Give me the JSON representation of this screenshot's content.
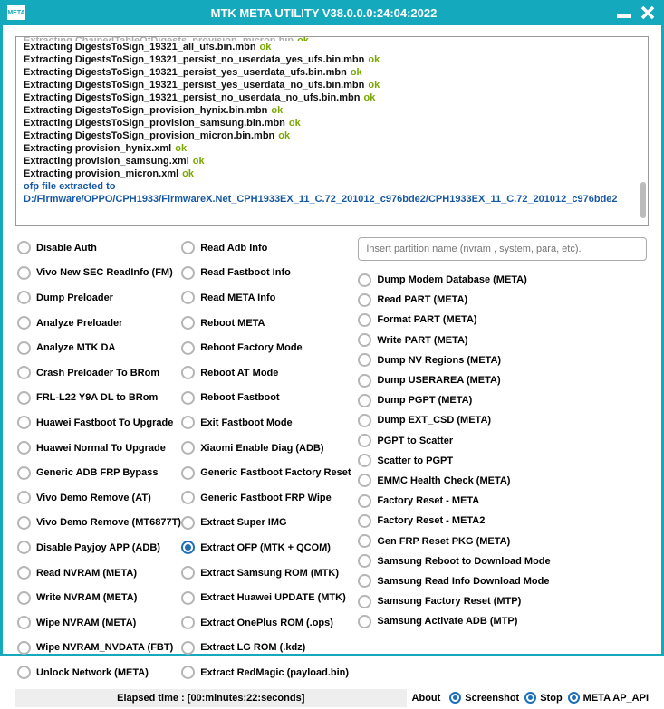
{
  "window": {
    "title": "MTK META UTILITY V38.0.0.0:24:04:2022",
    "logo_text": "META"
  },
  "log": {
    "lines": [
      {
        "text": "Extracting ChainedTableOfDigests_provision_micron.bin",
        "ok": true,
        "cutoff": true
      },
      {
        "text": "Extracting DigestsToSign_19321_all_ufs.bin.mbn",
        "ok": true
      },
      {
        "text": "Extracting DigestsToSign_19321_persist_no_userdata_yes_ufs.bin.mbn",
        "ok": true
      },
      {
        "text": "Extracting DigestsToSign_19321_persist_yes_userdata_ufs.bin.mbn",
        "ok": true
      },
      {
        "text": "Extracting DigestsToSign_19321_persist_yes_userdata_no_ufs.bin.mbn",
        "ok": true
      },
      {
        "text": "Extracting DigestsToSign_19321_persist_no_userdata_no_ufs.bin.mbn",
        "ok": true
      },
      {
        "text": "Extracting DigestsToSign_provision_hynix.bin.mbn",
        "ok": true
      },
      {
        "text": "Extracting DigestsToSign_provision_samsung.bin.mbn",
        "ok": true
      },
      {
        "text": "Extracting DigestsToSign_provision_micron.bin.mbn",
        "ok": true
      },
      {
        "text": "Extracting provision_hynix.xml",
        "ok": true
      },
      {
        "text": "Extracting provision_samsung.xml",
        "ok": true
      },
      {
        "text": "Extracting provision_micron.xml",
        "ok": true
      }
    ],
    "summary": "ofp file extracted to D:/Firmware/OPPO/CPH1933/FirmwareX.Net_CPH1933EX_11_C.72_201012_c976bde2/CPH1933EX_11_C.72_201012_c976bde2",
    "ok_label": "ok"
  },
  "partition_placeholder": "Insert partition name (nvram , system, para, etc).",
  "col1": [
    "Disable Auth",
    "Vivo New SEC ReadInfo (FM)",
    "Dump Preloader",
    "Analyze Preloader",
    "Analyze MTK DA",
    "Crash Preloader To BRom",
    "FRL-L22 Y9A DL to BRom",
    "Huawei Fastboot To Upgrade",
    "Huawei Normal To Upgrade",
    "Generic ADB FRP Bypass",
    "Vivo Demo Remove (AT)",
    "Vivo Demo Remove (MT6877T)",
    "Disable Payjoy APP (ADB)",
    "Read NVRAM (META)",
    "Write NVRAM (META)",
    "Wipe NVRAM (META)",
    "Wipe NVRAM_NVDATA (FBT)",
    "Unlock Network (META)"
  ],
  "col2": [
    "Read Adb Info",
    "Read Fastboot Info",
    "Read META Info",
    "Reboot META",
    "Reboot Factory Mode",
    "Reboot AT Mode",
    "Reboot Fastboot",
    "Exit Fastboot Mode",
    "Xiaomi Enable Diag (ADB)",
    "Generic Fastboot Factory Reset",
    "Generic Fastboot FRP Wipe",
    "Extract Super IMG",
    "Extract OFP (MTK + QCOM)",
    "Extract Samsung ROM (MTK)",
    "Extract Huawei UPDATE (MTK)",
    "Extract OnePlus ROM (.ops)",
    "Extract LG ROM (.kdz)",
    "Extract RedMagic (payload.bin)"
  ],
  "col2_selected_index": 12,
  "col3": [
    "Dump Modem Database (META)",
    "Read PART (META)",
    "Format PART (META)",
    "Write PART (META)",
    "Dump NV Regions (META)",
    "Dump USERAREA (META)",
    "Dump PGPT (META)",
    "Dump  EXT_CSD (META)",
    "PGPT to Scatter",
    "Scatter to PGPT",
    "EMMC Health Check (META)",
    "Factory Reset - META",
    "Factory Reset - META2",
    "Gen FRP Reset PKG (META)",
    "Samsung Reboot to Download Mode",
    "Samsung Read Info Download Mode",
    "Samsung Factory Reset (MTP)",
    "Samsung Activate ADB (MTP)"
  ],
  "footer": {
    "elapsed": "Elapsed time : [00:minutes:22:seconds]",
    "about": "About",
    "screenshot": "Screenshot",
    "stop": "Stop",
    "meta_ap_api": "META AP_API"
  }
}
